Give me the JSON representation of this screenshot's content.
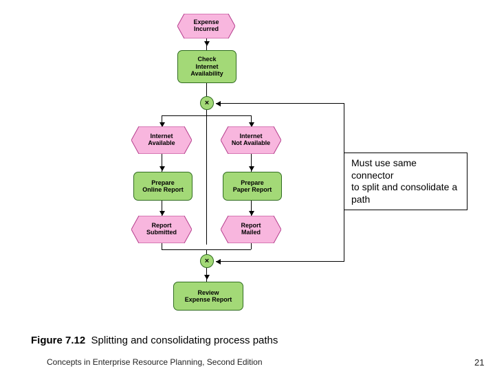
{
  "nodes": {
    "expense_incurred": "Expense\nIncurred",
    "check_internet": "Check\nInternet\nAvailability",
    "internet_available": "Internet\nAvailable",
    "internet_not_available": "Internet\nNot Available",
    "prepare_online": "Prepare\nOnline Report",
    "prepare_paper": "Prepare\nPaper Report",
    "report_submitted": "Report\nSubmitted",
    "report_mailed": "Report\nMailed",
    "review_expense": "Review\nExpense Report"
  },
  "connector_symbol": "×",
  "callout_text": "Must use same connector\nto split and consolidate a path",
  "caption_label": "Figure 7.12",
  "caption_text": "Splitting and consolidating process paths",
  "footer_text": "Concepts in Enterprise Resource Planning, Second Edition",
  "page_number": "21"
}
